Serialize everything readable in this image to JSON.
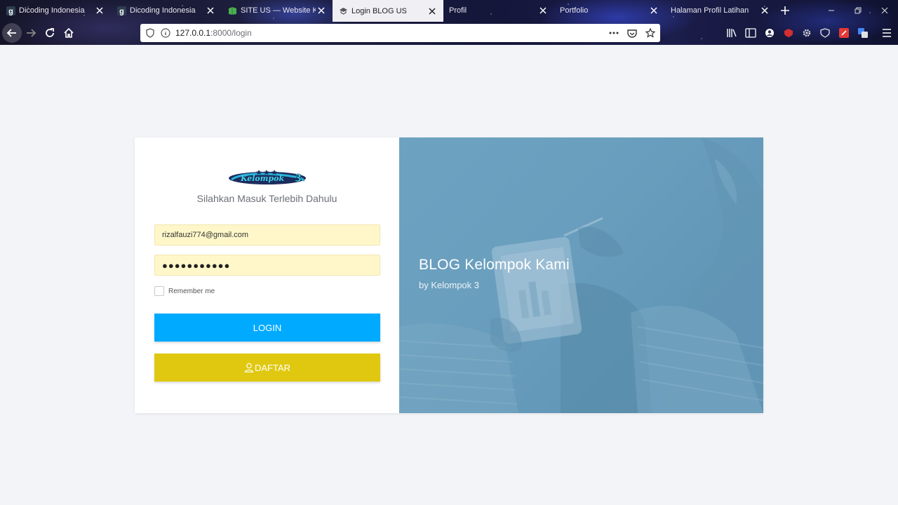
{
  "browser": {
    "tabs": [
      {
        "label": "Dicoding Indonesia",
        "favicon": "dicoding-icon",
        "active": false
      },
      {
        "label": "Dicoding Indonesia",
        "favicon": "dicoding-icon",
        "active": false
      },
      {
        "label": "SITE US — Website KEL",
        "favicon": "site-green-icon",
        "active": false
      },
      {
        "label": "Login BLOG US",
        "favicon": "blog-icon",
        "active": true
      },
      {
        "label": "Profil",
        "favicon": "",
        "active": false
      },
      {
        "label": "Portfolio",
        "favicon": "",
        "active": false
      },
      {
        "label": "Halaman Profil Latihan",
        "favicon": "",
        "active": false
      }
    ],
    "url_host": "127.0.0.1",
    "url_path": ":8000/login"
  },
  "login": {
    "logo_name": "Kelompok 3 logo",
    "subtitle": "Silahkan Masuk Terlebih Dahulu",
    "email_value": "rizalfauzi774@gmail.com",
    "password_mask": "●●●●●●●●●●●",
    "remember_label": "Remember me",
    "login_label": "LOGIN",
    "daftar_label": "DAFTAR"
  },
  "hero": {
    "title": "BLOG Kelompok Kami",
    "subtitle": "by Kelompok 3"
  },
  "colors": {
    "login_button": "#00aaff",
    "daftar_button": "#e0c810",
    "field_bg": "#fff7c9",
    "hero_overlay": "#6a9dbd",
    "page_bg": "#f3f4f7"
  }
}
